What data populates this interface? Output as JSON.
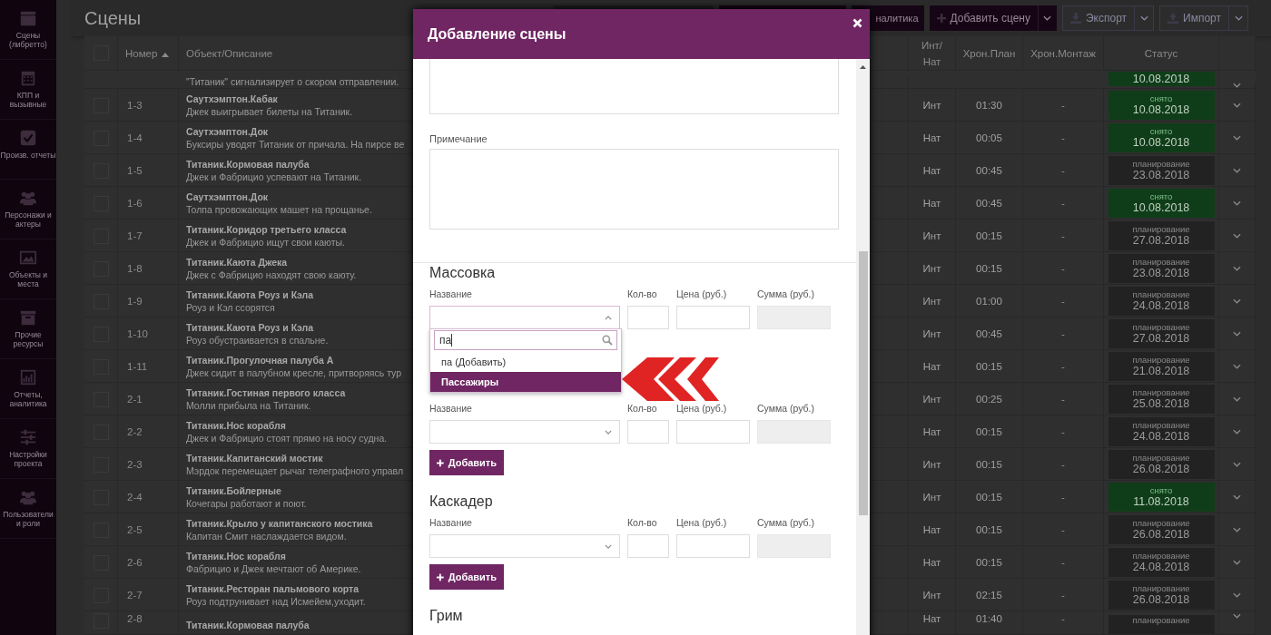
{
  "sidebar": {
    "items": [
      {
        "label": "Сцены (либретто)"
      },
      {
        "label": "КПП и вызывные"
      },
      {
        "label": "Произв. отчеты"
      },
      {
        "label": "Персонажи и актеры"
      },
      {
        "label": "Объекты и места"
      },
      {
        "label": "Прочие ресурсы"
      },
      {
        "label": "Отчеты, аналитика"
      },
      {
        "label": "Настройки проекта"
      },
      {
        "label": "Пользователи и роли"
      }
    ]
  },
  "page": {
    "title": "Сцены",
    "toolbar": [
      {
        "kind": "plain",
        "label": "налитика"
      },
      {
        "kind": "add",
        "label": "Добавить сцену"
      },
      {
        "kind": "export",
        "label": "Экспорт"
      },
      {
        "kind": "import",
        "label": "Импорт"
      }
    ]
  },
  "table": {
    "select_all": {
      "checked": false
    },
    "columns": [
      {
        "label": "Номер",
        "sorted": true
      },
      {
        "label": "Объект/Описание",
        "sorted": false
      },
      {
        "label": "Инт/\nНат",
        "sorted": false
      },
      {
        "label": "Хрон.План",
        "sorted": false
      },
      {
        "label": "Хрон.Монтаж",
        "sorted": false
      },
      {
        "label": "Статус",
        "sorted": false
      }
    ],
    "rows": [
      {
        "description": "\"Титаник\" сигнализирует о скором отправлении.",
        "status": {
          "kind": "shot",
          "date": "10.08.2018"
        }
      },
      {
        "checked": false,
        "number": "1-3",
        "title": "Саутхэмптон.Кабак",
        "description": "Джек выигрывает билеты на Титаник.",
        "int_nat": "Инт",
        "plan": "01:30",
        "montage": "-",
        "status": {
          "kind": "shot",
          "label": "снято",
          "date": "10.08.2018"
        }
      },
      {
        "checked": false,
        "number": "1-4",
        "title": "Саутхэмптон.Док",
        "description": "Буксиры уводят Титаник от причала. На пирсе ве",
        "int_nat": "Нат",
        "plan": "00:05",
        "montage": "-",
        "status": {
          "kind": "shot",
          "label": "снято",
          "date": "10.08.2018"
        }
      },
      {
        "checked": false,
        "number": "1-5",
        "title": "Титаник.Кормовая палуба",
        "description": "Джек и Фабрицио успевают на Титаник.",
        "int_nat": "Нат",
        "plan": "00:45",
        "montage": "-",
        "status": {
          "kind": "planning",
          "label": "планирование",
          "date": "23.08.2018"
        }
      },
      {
        "checked": false,
        "number": "1-6",
        "title": "Саутхэмптон.Док",
        "description": "Толпа провожающих машет на прощанье.",
        "int_nat": "Нат",
        "plan": "00:45",
        "montage": "-",
        "status": {
          "kind": "shot",
          "label": "снято",
          "date": "10.08.2018"
        }
      },
      {
        "checked": false,
        "number": "1-7",
        "title": "Титаник.Коридор третьего класса",
        "description": "Джек и Фабрицио ищут свои каюты.",
        "int_nat": "Инт",
        "plan": "00:15",
        "montage": "-",
        "status": {
          "kind": "planning",
          "label": "планирование",
          "date": "27.08.2018"
        }
      },
      {
        "checked": false,
        "number": "1-8",
        "title": "Титаник.Каюта Джека",
        "description": "Джек с Фабрицио находят свою каюту.",
        "int_nat": "Инт",
        "plan": "00:15",
        "montage": "-",
        "status": {
          "kind": "planning",
          "label": "планирование",
          "date": "23.08.2018"
        }
      },
      {
        "checked": false,
        "number": "1-9",
        "title": "Титаник.Каюта Роуз и Кэла",
        "description": "Роуз и Кэл ссорятся",
        "int_nat": "Инт",
        "plan": "01:00",
        "montage": "-",
        "status": {
          "kind": "planning",
          "label": "планирование",
          "date": "24.08.2018"
        }
      },
      {
        "checked": false,
        "number": "1-10",
        "title": "Титаник.Каюта Роуз и Кэла",
        "description": "Роуз обустраивается в спальне.",
        "int_nat": "Инт",
        "plan": "00:45",
        "montage": "-",
        "status": {
          "kind": "planning",
          "label": "планирование",
          "date": "27.08.2018"
        }
      },
      {
        "checked": false,
        "number": "1-11",
        "title": "Титаник.Прогулочная палуба А",
        "description": "Джек сидит в палубном кресле, притворяясь тур",
        "int_nat": "Нат",
        "plan": "00:15",
        "montage": "-",
        "status": {
          "kind": "planning",
          "label": "планирование",
          "date": "21.08.2018"
        }
      },
      {
        "checked": false,
        "number": "2-1",
        "title": "Титаник.Гостиная первого класса",
        "description": "Молли прибыла на Титаник.",
        "int_nat": "Инт",
        "plan": "00:25",
        "montage": "-",
        "status": {
          "kind": "planning",
          "label": "планирование",
          "date": "25.08.2018"
        }
      },
      {
        "checked": false,
        "number": "2-2",
        "title": "Титаник.Нос корабля",
        "description": "Джек и Фабрицио стоят прямо на носу судна.",
        "int_nat": "Нат",
        "plan": "00:15",
        "montage": "-",
        "status": {
          "kind": "planning",
          "label": "планирование",
          "date": "24.08.2018"
        }
      },
      {
        "checked": false,
        "number": "2-3",
        "title": "Титаник.Капитанский мостик",
        "description": "Мэрдок перемещает рычаг телеграфного управл",
        "int_nat": "Инт",
        "plan": "00:15",
        "montage": "-",
        "status": {
          "kind": "planning",
          "label": "планирование",
          "date": "26.08.2018"
        }
      },
      {
        "checked": false,
        "number": "2-4",
        "title": "Титаник.Бойлерные",
        "description": "Кочегары работают и поют.",
        "int_nat": "Инт",
        "plan": "00:15",
        "montage": "-",
        "status": {
          "kind": "shot",
          "label": "снято",
          "date": "11.08.2018"
        }
      },
      {
        "checked": false,
        "number": "2-5",
        "title": "Титаник.Крыло у капитанского мостика",
        "description": "Капитан Смит наслаждается видом.",
        "int_nat": "Нат",
        "plan": "00:15",
        "montage": "-",
        "status": {
          "kind": "planning",
          "label": "планирование",
          "date": "26.08.2018"
        }
      },
      {
        "checked": false,
        "number": "2-6",
        "title": "Титаник.Нос корабля",
        "description": "Фабрицио и Джек мечтают об Америке.",
        "int_nat": "Нат",
        "plan": "00:15",
        "montage": "-",
        "status": {
          "kind": "planning",
          "label": "планирование",
          "date": "24.08.2018"
        }
      },
      {
        "checked": false,
        "number": "2-7",
        "title": "Титаник.Ресторан пальмового корта",
        "description": "Роуз подтрунивает над Исмейем,уходит.",
        "int_nat": "Инт",
        "plan": "02:15",
        "montage": "-",
        "status": {
          "kind": "planning",
          "label": "планирование",
          "date": "26.08.2018"
        }
      },
      {
        "checked": false,
        "number": "2-8",
        "title": "Титаник.Кормовая палуба",
        "int_nat": "Нат",
        "plan": "01:40",
        "montage": "-",
        "status": {
          "kind": "planning",
          "label": "планирование"
        }
      }
    ]
  },
  "modal": {
    "title": "Добавление сцены",
    "note_label": "Примечание",
    "sections": [
      {
        "heading": "Массовка",
        "labels": [
          "Название",
          "Кол-во",
          "Цена (руб.)",
          "Сумма (руб.)"
        ],
        "select_open": true,
        "dropdown": {
          "search_value": "па",
          "options": [
            {
              "label": "па (Добавить)",
              "selected": false
            },
            {
              "label": "Пассажиры",
              "selected": true
            }
          ]
        }
      },
      {
        "labels": [
          "Название",
          "Кол-во",
          "Цена (руб.)",
          "Сумма (руб.)"
        ],
        "select_open": false,
        "add_button": "Добавить"
      },
      {
        "heading": "Каскадер",
        "labels": [
          "Название",
          "Кол-во",
          "Цена (руб.)",
          "Сумма (руб.)"
        ],
        "select_open": false,
        "add_button": "Добавить"
      },
      {
        "heading": "Грим"
      }
    ]
  }
}
